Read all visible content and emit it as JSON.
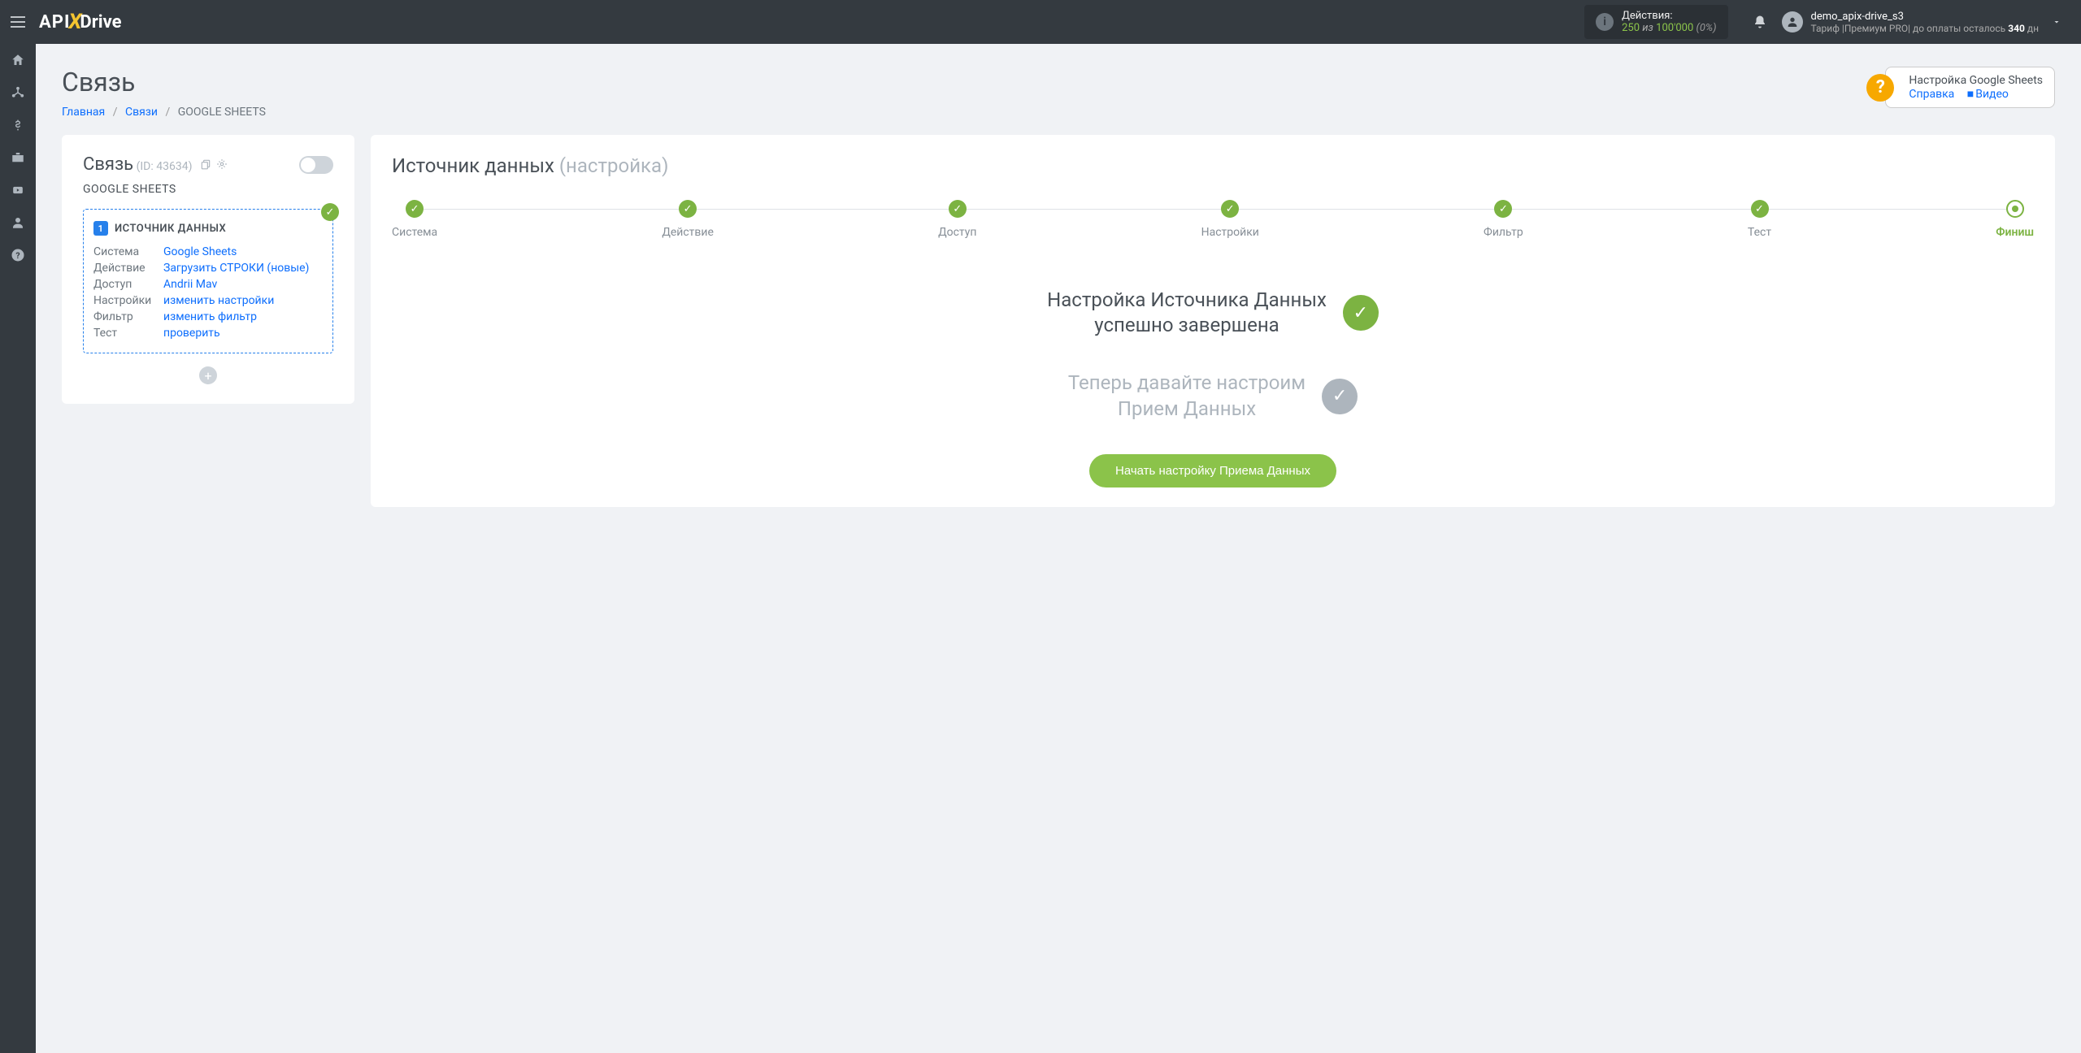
{
  "header": {
    "logo_api": "API",
    "logo_drive": "Drive",
    "actions_label": "Действия:",
    "actions_used": "250",
    "actions_sep": "из",
    "actions_total": "100'000",
    "actions_pct": "(0%)",
    "user_name": "demo_apix-drive_s3",
    "tariff_prefix": "Тариф |",
    "tariff_plan": "Премиум PRO",
    "tariff_suffix": "| до оплаты осталось",
    "days_left": "340",
    "days_unit": "дн"
  },
  "page": {
    "title": "Связь",
    "breadcrumbs": {
      "home": "Главная",
      "connections": "Связи",
      "current": "GOOGLE SHEETS"
    },
    "help": {
      "title": "Настройка Google Sheets",
      "ref": "Справка",
      "video": "Видео"
    }
  },
  "connection": {
    "title": "Связь",
    "id": "(ID: 43634)",
    "subtitle": "GOOGLE SHEETS",
    "source_title": "ИСТОЧНИК ДАННЫХ",
    "rows": {
      "system": {
        "key": "Система",
        "val": "Google Sheets"
      },
      "action": {
        "key": "Действие",
        "val": "Загрузить СТРОКИ (новые)"
      },
      "access": {
        "key": "Доступ",
        "val": "Andrii Mav"
      },
      "settings": {
        "key": "Настройки",
        "val": "изменить настройки"
      },
      "filter": {
        "key": "Фильтр",
        "val": "изменить фильтр"
      },
      "test": {
        "key": "Тест",
        "val": "проверить"
      }
    }
  },
  "right": {
    "title": "Источник данных",
    "title_suffix": "(настройка)",
    "steps": {
      "system": "Система",
      "action": "Действие",
      "access": "Доступ",
      "settings": "Настройки",
      "filter": "Фильтр",
      "test": "Тест",
      "finish": "Финиш"
    },
    "finish_line1": "Настройка Источника Данных",
    "finish_line2": "успешно завершена",
    "next_line1": "Теперь давайте настроим",
    "next_line2": "Прием Данных",
    "start_button": "Начать настройку Приема Данных"
  }
}
